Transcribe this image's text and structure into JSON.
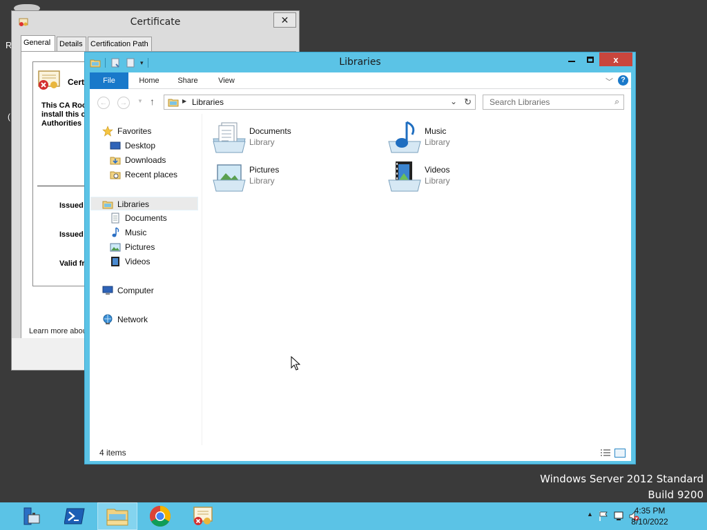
{
  "desktop": {
    "letters": [
      "R",
      "("
    ],
    "watermark": {
      "line1": "Windows Server 2012 Standard",
      "line2": "Build 9200"
    }
  },
  "certificate_window": {
    "title": "Certificate",
    "close_label": "✕",
    "tabs": [
      "General",
      "Details",
      "Certification Path"
    ],
    "active_tab": "General",
    "header": "Certi",
    "text_lines": [
      "This CA Roo",
      "install this c",
      "Authorities"
    ],
    "fields": [
      "Issued",
      "Issued",
      "Valid fr"
    ],
    "learn_more": "Learn more abou"
  },
  "explorer": {
    "title": "Libraries",
    "close_label": "x",
    "ribbon_tabs": [
      "File",
      "Home",
      "Share",
      "View"
    ],
    "help_label": "?",
    "address_path": "Libraries",
    "search_placeholder": "Search Libraries",
    "nav": {
      "favorites": {
        "label": "Favorites",
        "items": [
          "Desktop",
          "Downloads",
          "Recent places"
        ]
      },
      "libraries": {
        "label": "Libraries",
        "items": [
          "Documents",
          "Music",
          "Pictures",
          "Videos"
        ]
      },
      "computer": "Computer",
      "network": "Network"
    },
    "items": [
      {
        "name": "Documents",
        "type": "Library",
        "icon": "documents-library-icon"
      },
      {
        "name": "Music",
        "type": "Library",
        "icon": "music-library-icon"
      },
      {
        "name": "Pictures",
        "type": "Library",
        "icon": "pictures-library-icon"
      },
      {
        "name": "Videos",
        "type": "Library",
        "icon": "videos-library-icon"
      }
    ],
    "status": "4 items"
  },
  "taskbar": {
    "apps": [
      "server-manager-icon",
      "powershell-icon",
      "file-explorer-icon",
      "chrome-icon",
      "certificate-icon"
    ],
    "active_app": "file-explorer-icon",
    "time": "4:35 PM",
    "date": "8/10/2022"
  },
  "colors": {
    "window_frame": "#5bc3e6",
    "file_tab": "#1979ca",
    "close_button": "#c9463d",
    "desktop": "#3a3a3a"
  }
}
